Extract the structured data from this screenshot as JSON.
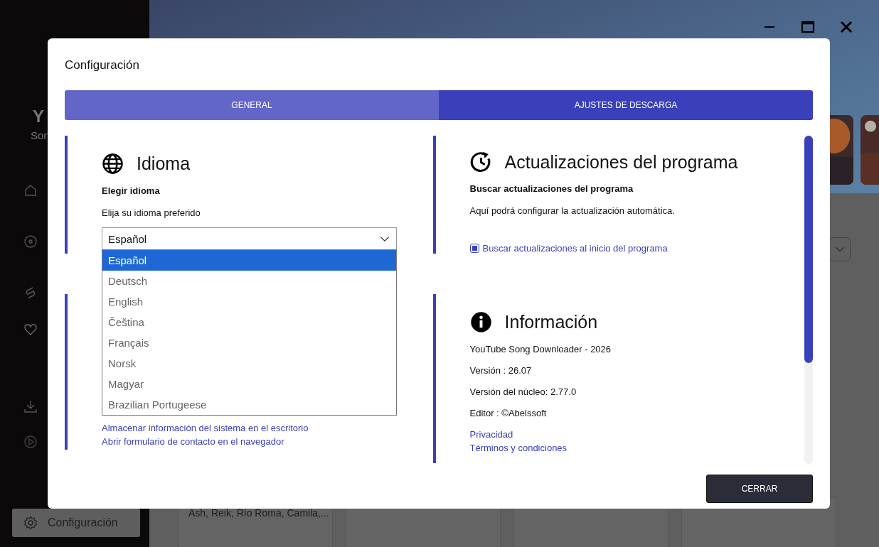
{
  "app": {
    "sidebar_title": "Y",
    "sidebar_subtitle": "Son",
    "settings_button": "Configuración",
    "artists": "Ash, Reik, Río Roma, Camila,..."
  },
  "dialog": {
    "title": "Configuración",
    "tabs": [
      {
        "label": "GENERAL",
        "selected": true
      },
      {
        "label": "AJUSTES DE DESCARGA",
        "selected": false
      }
    ],
    "language": {
      "heading": "Idioma",
      "label": "Elegir idioma",
      "hint": "Elija su idioma preferido",
      "value": "Español",
      "expanded": true,
      "options": [
        {
          "label": "Español",
          "selected": true
        },
        {
          "label": "Deutsch",
          "selected": false
        },
        {
          "label": "English",
          "selected": false
        },
        {
          "label": "Čeština",
          "selected": false
        },
        {
          "label": "Français",
          "selected": false
        },
        {
          "label": "Norsk",
          "selected": false
        },
        {
          "label": "Magyar",
          "selected": false
        },
        {
          "label": "Brazilian Portugeese",
          "selected": false
        }
      ]
    },
    "support_links": [
      "Almacenar información del sistema en el escritorio",
      "Abrir formulario de contacto en el navegador"
    ],
    "updates": {
      "heading": "Actualizaciones del programa",
      "label": "Buscar actualizaciones del programa",
      "hint": "Aquí podrá configurar la actualización automática.",
      "checkbox": {
        "label": "Buscar actualizaciones al inicio del programa",
        "checked": true
      }
    },
    "info": {
      "heading": "Información",
      "lines": [
        "YouTube Song Downloader - 2026",
        "Versión : 26.07",
        "Versión del núcleo: 2.77.0",
        "Editor : ©Abelssoft"
      ],
      "links": [
        "Privacidad",
        "Términos y condiciones"
      ]
    },
    "close_button": "CERRAR"
  }
}
